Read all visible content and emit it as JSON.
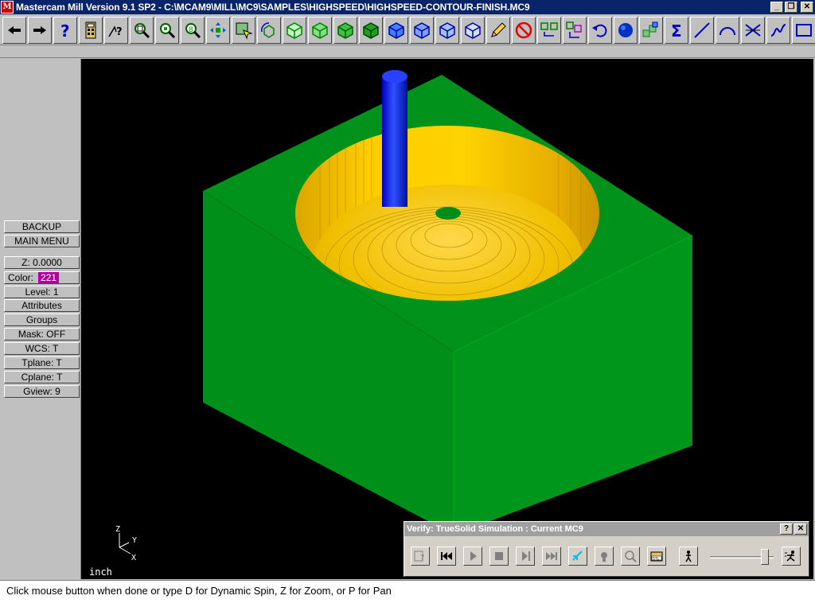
{
  "window": {
    "title": "Mastercam Mill Version 9.1 SP2 - C:\\MCAM9\\MILL\\MC9\\SAMPLES\\HIGHSPEED\\HIGHSPEED-CONTOUR-FINISH.MC9",
    "minimize": "_",
    "maximize": "❐",
    "close": "✕"
  },
  "toolbar": {
    "icons": [
      "back-arrow-icon",
      "forward-arrow-icon",
      "help-icon",
      "calculator-icon",
      "analyze-icon",
      "zoom-window-icon",
      "zoom-out-icon",
      "zoom-target-icon",
      "pan-icon",
      "select-icon",
      "rotate-icon",
      "view-top-icon",
      "view-front-icon",
      "view-side-icon",
      "view-iso-icon",
      "cube-blue-1-icon",
      "cube-blue-2-icon",
      "cube-blue-3-icon",
      "cube-blue-4-icon",
      "pencil-icon",
      "no-screen-icon",
      "transform-icon",
      "translate-icon",
      "undo-icon",
      "shaded-sphere-icon",
      "multi-cube-icon",
      "sigma-icon",
      "line-icon",
      "arc-icon",
      "trim-icon",
      "spline-icon",
      "rectangle-icon"
    ]
  },
  "menu": {
    "backup": "BACKUP",
    "main_menu": "MAIN MENU",
    "z": "Z:  0.0000",
    "color_label": "Color:",
    "color_value": "221",
    "level": "Level:  1",
    "attributes": "Attributes",
    "groups": "Groups",
    "mask": "Mask:  OFF",
    "wcs": "WCS:   T",
    "tplane": "Tplane:  T",
    "cplane": "Cplane:  T",
    "gview": "Gview:   9"
  },
  "viewport": {
    "units": "inch",
    "axes": {
      "z": "Z",
      "y": "Y",
      "x": "X"
    }
  },
  "verify": {
    "title": "Verify: TrueSolid Simulation : Current MC9",
    "help": "?",
    "close": "✕",
    "speed": 0.92,
    "icons": [
      "options-icon",
      "rewind-icon",
      "play-icon",
      "stop-icon",
      "step-icon",
      "fast-forward-icon",
      "cursor-icon",
      "light-icon",
      "zoom-tool-icon",
      "save-stl-icon"
    ]
  },
  "prompt": {
    "text": "Click mouse button when done or type D for Dynamic Spin, Z for Zoom, or P for Pan"
  }
}
